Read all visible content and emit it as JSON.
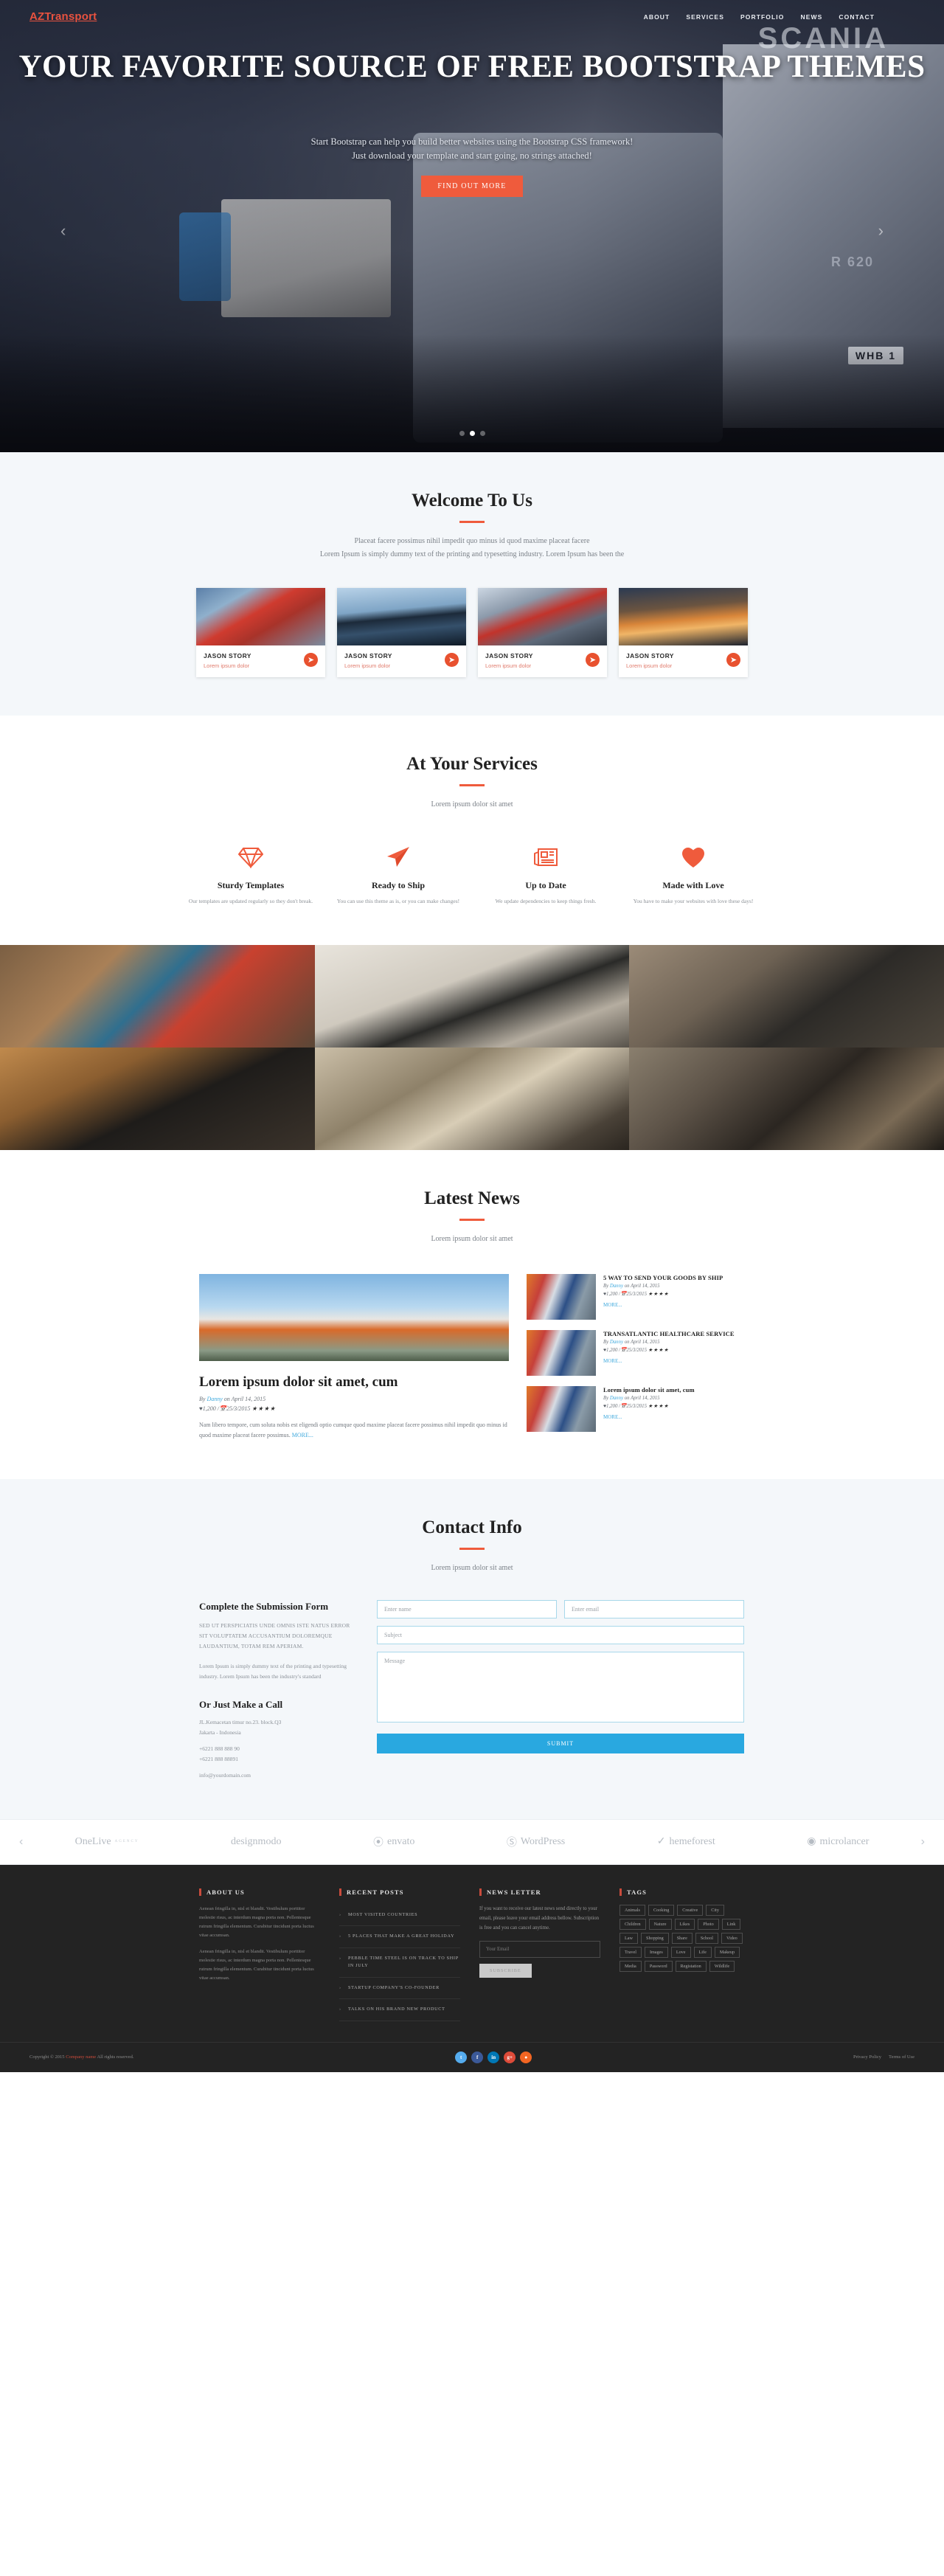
{
  "brand": "AZTransport",
  "nav": {
    "items": [
      {
        "label": "ABOUT"
      },
      {
        "label": "SERVICES"
      },
      {
        "label": "PORTFOLIO"
      },
      {
        "label": "NEWS"
      },
      {
        "label": "CONTACT"
      }
    ]
  },
  "hero": {
    "title": "YOUR FAVORITE SOURCE OF FREE BOOTSTRAP THEMES",
    "subtitle_line1": "Start Bootstrap can help you build better websites using the Bootstrap CSS framework!",
    "subtitle_line2": "Just download your template and start going, no strings attached!",
    "cta": "FIND OUT MORE",
    "prev_arrow": "‹",
    "next_arrow": "›",
    "truck_badge": "SCANIA",
    "truck_model": "R 620",
    "plate": "WHB  1",
    "accent": "#ef5b3c"
  },
  "welcome": {
    "title": "Welcome To Us",
    "sub_line1": "Placeat facere possimus nihil impedit quo minus id quod maxime placeat facere",
    "sub_line2": "Lorem Ipsum is simply dummy text of the printing and typesetting industry. Lorem Ipsum has been the",
    "cards": [
      {
        "title": "JASON STORY",
        "text": "Lorem ipsum dolor",
        "arrow": "➤"
      },
      {
        "title": "JASON STORY",
        "text": "Lorem ipsum dolor",
        "arrow": "➤"
      },
      {
        "title": "JASON STORY",
        "text": "Lorem ipsum dolor",
        "arrow": "➤"
      },
      {
        "title": "JASON STORY",
        "text": "Lorem ipsum dolor",
        "arrow": "➤"
      }
    ]
  },
  "services": {
    "title": "At Your Services",
    "sub": "Lorem ipsum dolor sit amet",
    "items": [
      {
        "icon": "diamond-icon",
        "name": "Sturdy Templates",
        "desc": "Our templates are updated regularly so they don't break."
      },
      {
        "icon": "paper-plane-icon",
        "name": "Ready to Ship",
        "desc": "You can use this theme as is, or you can make changes!"
      },
      {
        "icon": "newspaper-icon",
        "name": "Up to Date",
        "desc": "We update dependencies to keep things fresh."
      },
      {
        "icon": "heart-icon",
        "name": "Made with Love",
        "desc": "You have to make your websites with love these days!"
      }
    ]
  },
  "news": {
    "title": "Latest News",
    "sub": "Lorem ipsum dolor sit amet",
    "featured": {
      "title": "Lorem ipsum dolor sit amet, cum",
      "by_prefix": "By ",
      "by_author": "Danny",
      "by_suffix": " on April 14, 2015",
      "likes": "1,200",
      "date": "25/3/2015",
      "stars": "★★★★",
      "half_star": "★",
      "body": "Nam libero tempore, cum soluta nobis est eligendi optio cumque quod maxime placeat facere possimus nihil impedit quo minus id quod maxime placeat facere possimus.",
      "more": "MORE..."
    },
    "items": [
      {
        "title": "5 WAY TO SEND YOUR GOODS BY SHIP",
        "by_prefix": "By ",
        "by_author": "Danny",
        "by_suffix": " on April 14, 2015",
        "likes": "1,200",
        "date": "25/3/2015",
        "stars": "★★★★",
        "half_star": "★",
        "more": "MORE..."
      },
      {
        "title": "TRANSATLANTIC HEALTHCARE SERVICE",
        "by_prefix": "By ",
        "by_author": "Danny",
        "by_suffix": " on April 14, 2015",
        "likes": "1,200",
        "date": "25/3/2015",
        "stars": "★★★★",
        "half_star": "★",
        "more": "MORE..."
      },
      {
        "title": "Lorem ipsum dolor sit amet, cum",
        "by_prefix": "By ",
        "by_author": "Danny",
        "by_suffix": " on April 14, 2015",
        "likes": "1,200",
        "date": "25/3/2015",
        "stars": "★★★★",
        "half_star": "★",
        "more": "MORE..."
      }
    ]
  },
  "contact": {
    "title": "Contact Info",
    "sub": "Lorem ipsum dolor sit amet",
    "form_heading": "Complete the Submission Form",
    "caps_text": "SED UT PERSPICIATIS UNDE OMNIS ISTE NATUS ERROR SIT VOLUPTATEM ACCUSANTIUM DOLOREMQUE LAUDANTIUM, TOTAM REM APERIAM.",
    "para": "Lorem Ipsum is simply dummy text of the printing and typesetting industry. Lorem Ipsum has been the industry's standard",
    "call_heading": "Or Just Make a Call",
    "address_line1": "JL.Kemacetan timur no.23. block.Q3",
    "address_line2": "Jakarta - Indonesia",
    "phone1": "+6221 888 888 90",
    "phone2": "+6221 888 88891",
    "email": "info@yourdomain.com",
    "placeholders": {
      "name": "Enter name",
      "email": "Enter email",
      "subject": "Subject",
      "message": "Message"
    },
    "submit": "SUBMIT"
  },
  "partners": {
    "prev": "‹",
    "next": "›",
    "items": [
      {
        "name": "OneLive",
        "sub": "AGENCY"
      },
      {
        "name": "designmodo",
        "sub": ""
      },
      {
        "name": "envato",
        "sub": ""
      },
      {
        "name": "WordPress",
        "sub": ""
      },
      {
        "name": "hemeforest",
        "sub": ""
      },
      {
        "name": "microlancer",
        "sub": ""
      }
    ]
  },
  "footer": {
    "about": {
      "heading": "ABOUT US",
      "p1": "Aenean fringilla in, nisl et blandit. Vestibulum porttitor molestie risus, ac interdum magna porta non. Pellentesque rutrum fringilla elementum. Curabitur tincidunt porta luctus vitae accumsan.",
      "p2": "Aenean fringilla in, nisl et blandit. Vestibulum porttitor molestie risus, ac interdum magna porta non. Pellentesque rutrum fringilla elementum. Curabitur tincidunt porta luctus vitae accumsan."
    },
    "recent": {
      "heading": "RECENT POSTS",
      "posts": [
        "MOST VISITED COUNTRIES",
        "5 PLACES THAT MAKE A GREAT HOLIDAY",
        "PEBBLE TIME STEEL IS ON TRACK TO SHIP IN JULY",
        "STARTUP COMPANY'S CO-FOUNDER",
        "TALKS ON HIS BRAND NEW PRODUCT"
      ]
    },
    "newsletter": {
      "heading": "NEWS LETTER",
      "text": "If you want to receive our latest news send directly to your email, please leave your email address bellow. Subscription is free and you can cancel anytime.",
      "placeholder": "Your Email",
      "button": "SUBSCRIBE"
    },
    "tags": {
      "heading": "TAGS",
      "items": [
        "Animals",
        "Cooking",
        "Creative",
        "City",
        "Children",
        "Nature",
        "Likes",
        "Photo",
        "Link",
        "Law",
        "Shopping",
        "Share",
        "School",
        "Video",
        "Travel",
        "Images",
        "Love",
        "Life",
        "Makeup",
        "Media",
        "Password",
        "Registation",
        "Wildlife"
      ]
    },
    "copyright_pre": "Copyright © 2015 ",
    "copyright_brand": "Company name",
    "copyright_post": " All rights reserved.",
    "socials": [
      {
        "name": "twitter-icon",
        "glyph": "t",
        "color": "#55acee"
      },
      {
        "name": "facebook-icon",
        "glyph": "f",
        "color": "#3b5998"
      },
      {
        "name": "linkedin-icon",
        "glyph": "in",
        "color": "#0077b5"
      },
      {
        "name": "google-plus-icon",
        "glyph": "g+",
        "color": "#dd4b39"
      },
      {
        "name": "rss-icon",
        "glyph": "●",
        "color": "#f26522"
      }
    ],
    "legal": [
      {
        "label": "Privacy Policy"
      },
      {
        "label": "Terms of Use"
      }
    ]
  }
}
